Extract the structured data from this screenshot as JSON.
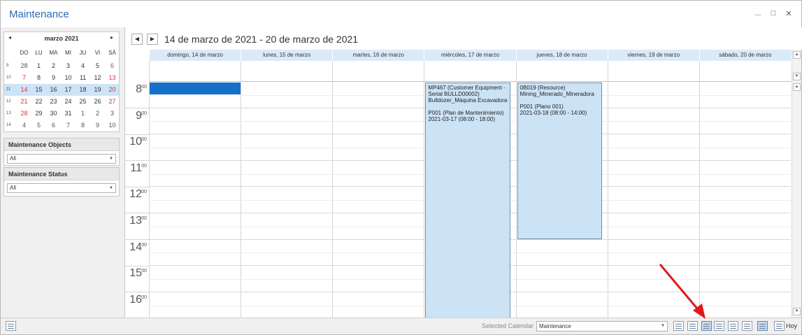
{
  "window": {
    "title": "Maintenance",
    "buttons": [
      "...",
      "□",
      "✕"
    ]
  },
  "mini_calendar": {
    "month_label": "marzo 2021",
    "prev": "◂",
    "next": "▸",
    "weekdays": [
      "DO",
      "LU",
      "MA",
      "MI",
      "JU",
      "VI",
      "SÁ"
    ],
    "weeks": [
      {
        "wk": "9",
        "days": [
          "28",
          "1",
          "2",
          "3",
          "4",
          "5",
          "6"
        ]
      },
      {
        "wk": "10",
        "days": [
          "7",
          "8",
          "9",
          "10",
          "11",
          "12",
          "13"
        ]
      },
      {
        "wk": "11",
        "days": [
          "14",
          "15",
          "16",
          "17",
          "18",
          "19",
          "20"
        ]
      },
      {
        "wk": "12",
        "days": [
          "21",
          "22",
          "23",
          "24",
          "25",
          "26",
          "27"
        ]
      },
      {
        "wk": "13",
        "days": [
          "28",
          "29",
          "30",
          "31",
          "1",
          "2",
          "3"
        ]
      },
      {
        "wk": "14",
        "days": [
          "4",
          "5",
          "6",
          "7",
          "8",
          "9",
          "10"
        ]
      }
    ],
    "selected_week_index": 2
  },
  "filters": {
    "objects": {
      "label": "Maintenance Objects",
      "value": "All"
    },
    "status": {
      "label": "Maintenance Status",
      "value": "All"
    }
  },
  "scheduler": {
    "range_title": "14 de marzo de 2021 - 20 de marzo de 2021",
    "days": [
      "domingo, 14 de marzo",
      "lunes, 15 de marzo",
      "martes, 16 de marzo",
      "miércoles, 17 de marzo",
      "jueves, 18 de marzo",
      "viernes, 19 de marzo",
      "sábado, 20 de marzo"
    ],
    "hours": [
      {
        "h": "8",
        "m": "00"
      },
      {
        "h": "9",
        "m": "00"
      },
      {
        "h": "10",
        "m": "00"
      },
      {
        "h": "11",
        "m": "00"
      },
      {
        "h": "12",
        "m": "00"
      },
      {
        "h": "13",
        "m": "00"
      },
      {
        "h": "14",
        "m": "00"
      },
      {
        "h": "15",
        "m": "00"
      },
      {
        "h": "16",
        "m": "00"
      }
    ],
    "appointments": [
      {
        "lines": [
          "MP467 (Customer Equipment -",
          "Serial BULLD00002)",
          "Bulldozer_Máquina Excavadora",
          "",
          "P001 (Plan de Mantenimiento)",
          "2021-03-17 (08:00 - 18:00)"
        ]
      },
      {
        "lines": [
          "0B019 (Resource)",
          "Mining_Minerado_Mineradora",
          "",
          "P001 (Plano 001)",
          "2021-03-18 (08:00 - 14:00)"
        ]
      }
    ]
  },
  "statusbar": {
    "selected_calendar_label": "Selected Calendar",
    "selected_calendar_value": "Maintenance",
    "today_label": "Hoy"
  },
  "colors": {
    "accent": "#2b6cb0",
    "appointment": "#cce3f6",
    "selection": "#1470c8",
    "weekend_red": "#d93030",
    "arrow": "#e0191b"
  }
}
